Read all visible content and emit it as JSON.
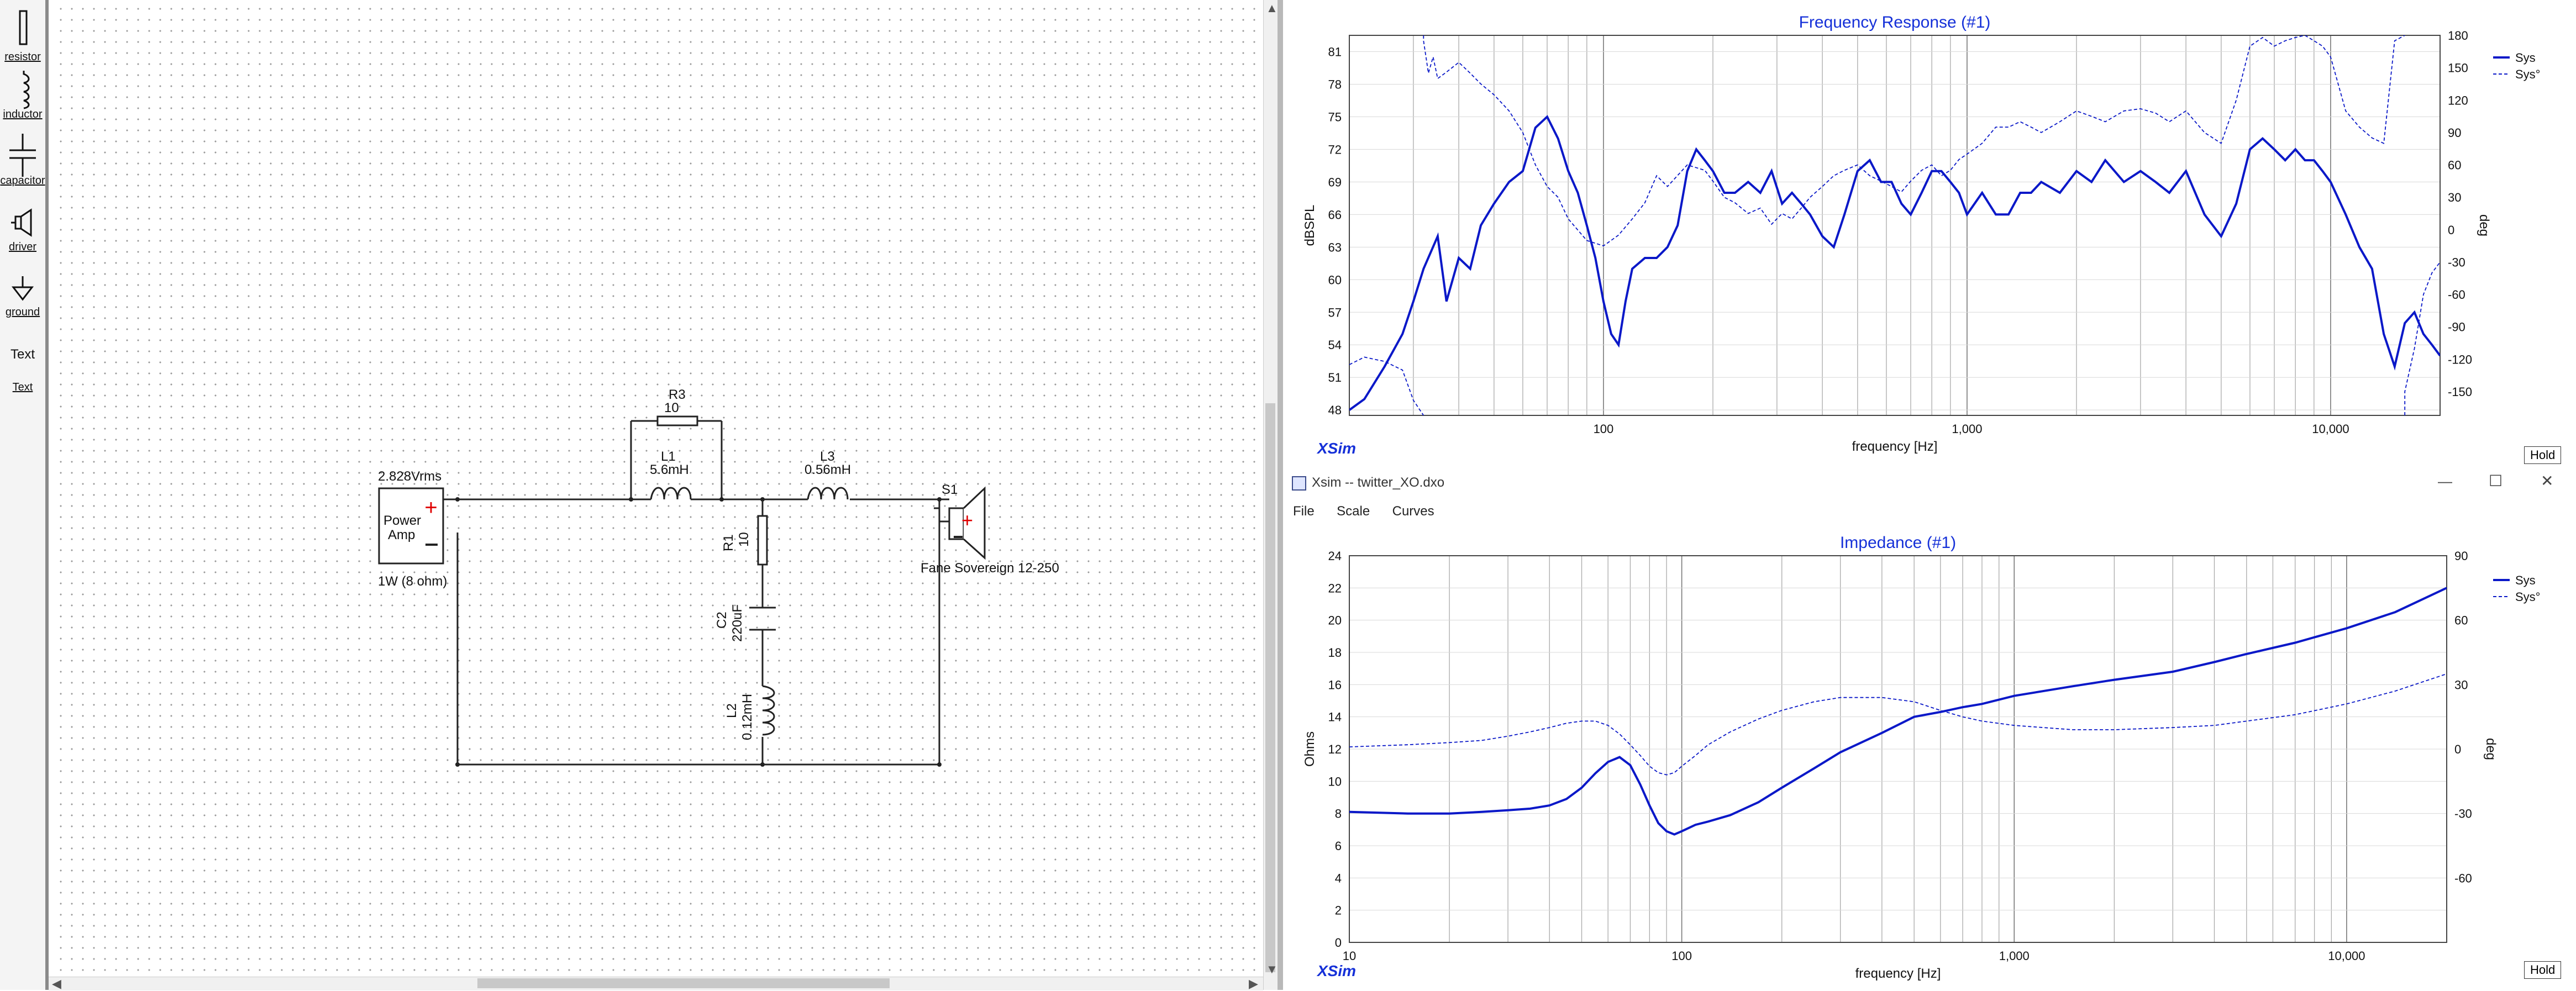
{
  "toolbox": {
    "items": [
      {
        "label": "resistor",
        "icon": "resistor-icon"
      },
      {
        "label": "inductor",
        "icon": "inductor-icon"
      },
      {
        "label": "capacitor",
        "icon": "capacitor-icon"
      },
      {
        "label": "driver",
        "icon": "driver-icon"
      },
      {
        "label": "ground",
        "icon": "ground-icon"
      },
      {
        "label": "Text",
        "icon": "text-tool-icon"
      },
      {
        "label": "Text",
        "icon": "text-link"
      }
    ]
  },
  "schematic": {
    "amp": {
      "voltage": "2.828Vrms",
      "name_line1": "Power",
      "name_line2": "Amp",
      "note": "1W (8 ohm)"
    },
    "R3": {
      "name": "R3",
      "value": "10"
    },
    "L1": {
      "name": "L1",
      "value": "5.6mH"
    },
    "L3": {
      "name": "L3",
      "value": "0.56mH"
    },
    "R1": {
      "name": "R1",
      "value": "10"
    },
    "C2": {
      "name": "C2",
      "value": "220uF"
    },
    "L2": {
      "name": "L2",
      "value": "0.12mH"
    },
    "S1": {
      "name": "S1",
      "model": "Fane Sovereign 12-250"
    }
  },
  "freq_window": {
    "hold_label": "Hold",
    "logo": "XSim"
  },
  "imp_window": {
    "title": "Xsim -- twitter_XO.dxo",
    "menu": [
      "File",
      "Scale",
      "Curves"
    ],
    "hold_label": "Hold",
    "logo": "XSim",
    "controls": [
      "—",
      "☐",
      "✕"
    ]
  },
  "chart_data": [
    {
      "type": "line",
      "title": "Frequency Response (#1)",
      "xlabel": "frequency [Hz]",
      "ylabel": "dBSPL",
      "y2label": "deg",
      "xscale": "log",
      "xlim": [
        20,
        20000
      ],
      "ylim": [
        47.5,
        82.5
      ],
      "y2lim": [
        -172,
        180
      ],
      "x_ticks": [
        "100",
        "1,000",
        "10,000"
      ],
      "y_ticks": [
        48,
        51,
        54,
        57,
        60,
        63,
        66,
        69,
        72,
        75,
        78,
        81
      ],
      "y2_ticks": [
        -150,
        -120,
        -90,
        -60,
        -30,
        0,
        30,
        60,
        90,
        120,
        150,
        180
      ],
      "legend_position": "right",
      "colors": {
        "curve": "#0a18c8"
      },
      "series": [
        {
          "name": "Sys",
          "style": "solid",
          "x": [
            20,
            22,
            25,
            28,
            30,
            32,
            35,
            37,
            40,
            43,
            46,
            50,
            55,
            60,
            65,
            70,
            75,
            80,
            85,
            90,
            95,
            100,
            105,
            110,
            115,
            120,
            130,
            140,
            150,
            160,
            170,
            180,
            190,
            200,
            215,
            230,
            250,
            270,
            290,
            310,
            330,
            350,
            370,
            400,
            430,
            460,
            500,
            540,
            580,
            620,
            660,
            700,
            750,
            800,
            850,
            900,
            950,
            1000,
            1100,
            1200,
            1300,
            1400,
            1500,
            1600,
            1800,
            2000,
            2200,
            2400,
            2700,
            3000,
            3300,
            3600,
            4000,
            4500,
            5000,
            5500,
            6000,
            6500,
            7000,
            7500,
            8000,
            8500,
            9000,
            9500,
            10000,
            11000,
            12000,
            13000,
            14000,
            15000,
            16000,
            17000,
            18000,
            19000,
            20000
          ],
          "y": [
            48,
            49,
            52,
            55,
            58,
            61,
            64,
            58,
            62,
            61,
            65,
            67,
            69,
            70,
            74,
            75,
            73,
            70,
            68,
            65,
            62,
            58,
            55,
            54,
            58,
            61,
            62,
            62,
            63,
            65,
            70,
            72,
            71,
            70,
            68,
            68,
            69,
            68,
            70,
            67,
            68,
            67,
            66,
            64,
            63,
            66,
            70,
            71,
            69,
            69,
            67,
            66,
            68,
            70,
            70,
            69,
            68,
            66,
            68,
            66,
            66,
            68,
            68,
            69,
            68,
            70,
            69,
            71,
            69,
            70,
            69,
            68,
            70,
            66,
            64,
            67,
            72,
            73,
            72,
            71,
            72,
            71,
            71,
            70,
            69,
            66,
            63,
            61,
            55,
            52,
            56,
            57,
            55,
            54,
            53
          ]
        },
        {
          "name": "Sys°",
          "style": "dashed",
          "x": [
            20,
            22,
            25,
            28,
            30,
            32,
            33,
            34,
            35,
            37,
            40,
            43,
            46,
            50,
            55,
            60,
            65,
            70,
            75,
            80,
            90,
            100,
            110,
            120,
            130,
            140,
            150,
            170,
            190,
            200,
            215,
            230,
            250,
            270,
            290,
            310,
            330,
            350,
            370,
            400,
            430,
            460,
            500,
            540,
            580,
            620,
            660,
            700,
            750,
            800,
            850,
            900,
            950,
            1000,
            1100,
            1200,
            1300,
            1400,
            1500,
            1600,
            1800,
            2000,
            2200,
            2400,
            2700,
            3000,
            3300,
            3600,
            4000,
            4500,
            5000,
            5500,
            6000,
            6500,
            7000,
            7500,
            8000,
            8500,
            9000,
            9500,
            10000,
            11000,
            12000,
            13000,
            14000,
            15000,
            16000,
            17000,
            18000,
            19000,
            20000
          ],
          "y": [
            -125,
            -118,
            -122,
            -130,
            -158,
            175,
            145,
            160,
            140,
            146,
            155,
            145,
            135,
            125,
            110,
            90,
            60,
            40,
            30,
            10,
            -10,
            -15,
            -5,
            10,
            25,
            50,
            40,
            60,
            55,
            45,
            30,
            25,
            15,
            20,
            5,
            15,
            10,
            20,
            30,
            40,
            50,
            55,
            60,
            50,
            45,
            40,
            35,
            45,
            55,
            60,
            50,
            55,
            65,
            70,
            80,
            95,
            95,
            100,
            95,
            90,
            100,
            110,
            105,
            100,
            110,
            112,
            108,
            100,
            110,
            90,
            80,
            120,
            170,
            178,
            170,
            175,
            178,
            180,
            175,
            170,
            160,
            110,
            95,
            85,
            80,
            175,
            -150,
            -110,
            -60,
            -40,
            -30
          ]
        }
      ]
    },
    {
      "type": "line",
      "title": "Impedance (#1)",
      "xlabel": "frequency [Hz]",
      "ylabel": "Ohms",
      "y2label": "deg",
      "xscale": "log",
      "xlim": [
        10,
        20000
      ],
      "ylim": [
        0,
        24
      ],
      "y2lim": [
        -90,
        90
      ],
      "x_ticks": [
        "10",
        "100",
        "1,000",
        "10,000"
      ],
      "y_ticks": [
        0,
        2,
        4,
        6,
        8,
        10,
        12,
        14,
        16,
        18,
        20,
        22,
        24
      ],
      "y2_ticks": [
        -60,
        -30,
        0,
        30,
        60,
        90
      ],
      "legend_position": "right",
      "colors": {
        "curve": "#0a18c8"
      },
      "series": [
        {
          "name": "Sys",
          "style": "solid",
          "x": [
            10,
            15,
            20,
            25,
            30,
            35,
            40,
            45,
            50,
            55,
            60,
            65,
            70,
            75,
            80,
            85,
            90,
            95,
            100,
            110,
            120,
            140,
            170,
            200,
            250,
            300,
            400,
            500,
            600,
            700,
            800,
            1000,
            1500,
            2000,
            3000,
            4000,
            5000,
            7000,
            10000,
            14000,
            20000
          ],
          "y": [
            8.1,
            8.0,
            8.0,
            8.1,
            8.2,
            8.3,
            8.5,
            8.9,
            9.6,
            10.5,
            11.2,
            11.5,
            11.0,
            9.8,
            8.5,
            7.4,
            6.9,
            6.7,
            6.9,
            7.3,
            7.5,
            7.9,
            8.7,
            9.6,
            10.8,
            11.8,
            13.0,
            14.0,
            14.3,
            14.6,
            14.8,
            15.3,
            15.9,
            16.3,
            16.8,
            17.4,
            17.9,
            18.6,
            19.5,
            20.5,
            22.0
          ]
        },
        {
          "name": "Sys°",
          "style": "dashed",
          "x": [
            10,
            15,
            20,
            25,
            30,
            35,
            40,
            45,
            50,
            55,
            60,
            65,
            70,
            75,
            80,
            85,
            90,
            95,
            100,
            110,
            120,
            140,
            170,
            200,
            250,
            300,
            400,
            500,
            600,
            700,
            800,
            1000,
            1500,
            2000,
            3000,
            4000,
            5000,
            7000,
            10000,
            14000,
            20000
          ],
          "y": [
            1,
            2,
            3,
            4,
            6,
            8,
            10,
            12,
            13,
            13,
            11,
            7,
            2,
            -3,
            -8,
            -11,
            -12,
            -11,
            -8,
            -3,
            2,
            8,
            14,
            18,
            22,
            24,
            24,
            22,
            18,
            15,
            13,
            11,
            9,
            9,
            10,
            11,
            13,
            16,
            21,
            27,
            35
          ]
        }
      ]
    }
  ]
}
